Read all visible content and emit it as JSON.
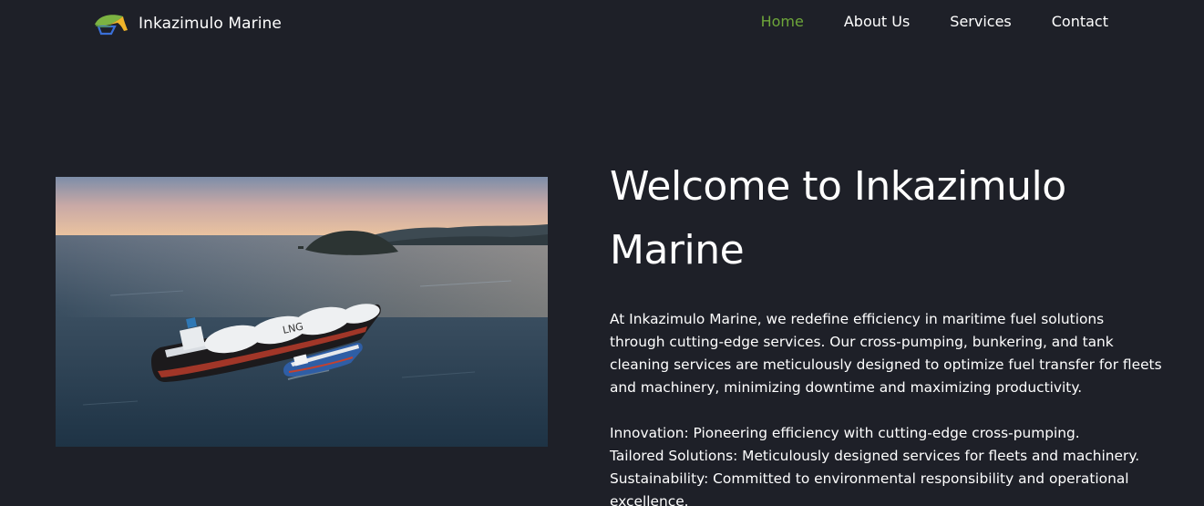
{
  "header": {
    "brand_name": "Inkazimulo Marine",
    "nav": [
      {
        "label": "Home",
        "active": true
      },
      {
        "label": "About Us",
        "active": false
      },
      {
        "label": "Services",
        "active": false
      },
      {
        "label": "Contact",
        "active": false
      }
    ]
  },
  "hero": {
    "title": "Welcome to Inkazimulo Marine",
    "intro": "At Inkazimulo Marine, we redefine efficiency in maritime fuel solutions through cutting-edge services. Our cross-pumping, bunkering, and tank cleaning services are meticulously designed to optimize fuel transfer for fleets and machinery, minimizing downtime and maximizing productivity.",
    "features": [
      "Innovation: Pioneering efficiency with cutting-edge cross-pumping.",
      "Tailored Solutions: Meticulously designed services for fleets and machinery.",
      "Sustainability: Committed to environmental responsibility and operational excellence."
    ],
    "image_ship_lettering": "LNG"
  },
  "colors": {
    "background": "#1e2028",
    "nav_active": "#6ea63a",
    "text": "#ffffff"
  },
  "icons": {
    "logo": "leaf-logo-icon"
  }
}
